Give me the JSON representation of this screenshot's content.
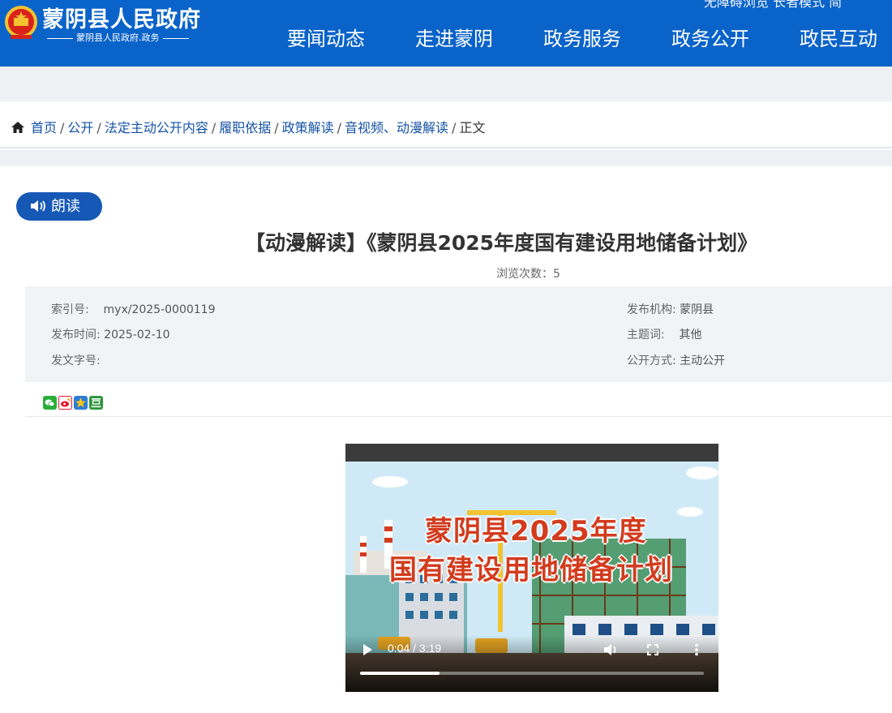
{
  "header": {
    "site_title": "蒙阴县人民政府",
    "site_subtitle": "蒙阴县人民政府.政务",
    "top_links": "无障碍浏览    长者模式    简",
    "nav": [
      "要闻动态",
      "走进蒙阴",
      "政务服务",
      "政务公开",
      "政民互动"
    ]
  },
  "breadcrumb": {
    "items": [
      "首页",
      "公开",
      "法定主动公开内容",
      "履职依据",
      "政策解读",
      "音视频、动漫解读"
    ],
    "current": "正文",
    "separator": "/"
  },
  "read_button": {
    "label": "朗读",
    "icon": "speaker-icon"
  },
  "article": {
    "title": "【动漫解读】《蒙阴县2025年度国有建设用地储备计划》",
    "views_label": "浏览次数：",
    "views": "5"
  },
  "meta": {
    "index_label": "索引号:",
    "index_value": "myx/2025-0000119",
    "publish_time_label": "发布时间:",
    "publish_time_value": "2025-02-10",
    "doc_number_label": "发文字号:",
    "doc_number_value": "",
    "org_label": "发布机构:",
    "org_value": "蒙阴县",
    "topic_label": "主题词:",
    "topic_value": "其他",
    "disclosure_label": "公开方式:",
    "disclosure_value": "主动公开"
  },
  "share": [
    "wechat-icon",
    "weibo-icon",
    "qzone-icon",
    "douban-icon"
  ],
  "share_colors": {
    "wechat": "#2aae3a",
    "weibo": "#e6162d",
    "qzone": "#2b7cd6",
    "douban": "#2e963d"
  },
  "video": {
    "caption_line1": "蒙阴县2025年度",
    "caption_line2": "国有建设用地储备计划",
    "current_time": "0:04",
    "duration": "3:19",
    "progress": 0.23
  },
  "colors": {
    "header_bg": "#0a63c9",
    "read_button_bg": "#1658b5",
    "link": "#1452a6"
  }
}
